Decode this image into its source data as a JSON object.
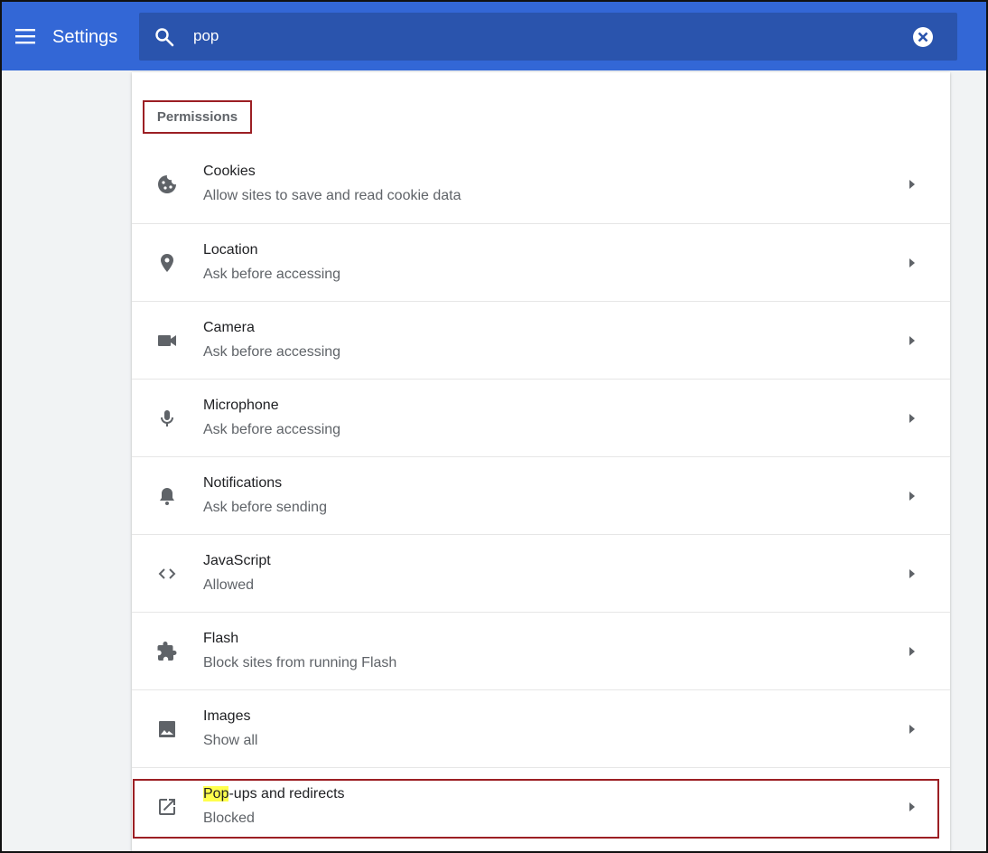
{
  "header": {
    "title": "Settings",
    "menu_icon": "hamburger-menu-icon",
    "search": {
      "value": "pop",
      "icon": "search-icon",
      "clear_icon": "clear-circle-icon"
    },
    "color": "#3367d6"
  },
  "permissions": {
    "section_title": "Permissions",
    "items": [
      {
        "title": "Cookies",
        "subtitle": "Allow sites to save and read cookie data",
        "icon": "cookie-icon"
      },
      {
        "title": "Location",
        "subtitle": "Ask before accessing",
        "icon": "location-pin-icon"
      },
      {
        "title": "Camera",
        "subtitle": "Ask before accessing",
        "icon": "camera-icon"
      },
      {
        "title": "Microphone",
        "subtitle": "Ask before accessing",
        "icon": "microphone-icon"
      },
      {
        "title": "Notifications",
        "subtitle": "Ask before sending",
        "icon": "bell-icon"
      },
      {
        "title": "JavaScript",
        "subtitle": "Allowed",
        "icon": "code-brackets-icon"
      },
      {
        "title": "Flash",
        "subtitle": "Block sites from running Flash",
        "icon": "puzzle-piece-icon"
      },
      {
        "title": "Images",
        "subtitle": "Show all",
        "icon": "image-icon"
      },
      {
        "title_highlight": "Pop",
        "title_rest": "-ups and redirects",
        "subtitle": "Blocked",
        "icon": "open-in-new-icon"
      }
    ]
  },
  "annotation_color": "#9c1f24",
  "search_highlight_color": "#ffff4d"
}
